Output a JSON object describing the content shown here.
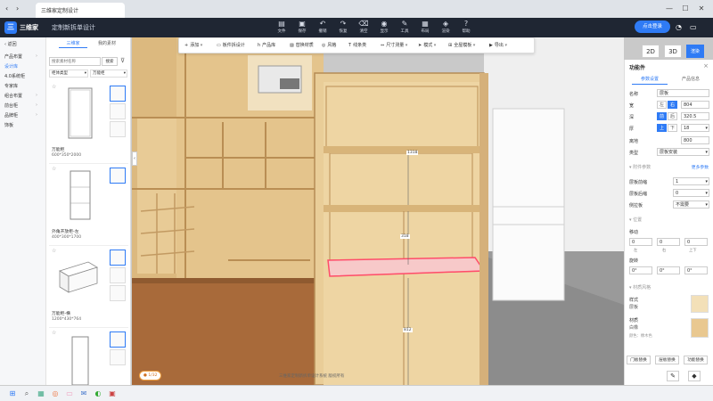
{
  "browser": {
    "tab_title": "三维家定制设计",
    "controls": [
      "—",
      "☐",
      "✕"
    ]
  },
  "header": {
    "logo_text": "三",
    "brand": "三维家",
    "subtitle": "定制新拆单设计",
    "tools": [
      {
        "icon": "file-icon",
        "glyph": "▤",
        "label": "文件"
      },
      {
        "icon": "save-icon",
        "glyph": "▣",
        "label": "保存"
      },
      {
        "icon": "undo-icon",
        "glyph": "↶",
        "label": "撤销"
      },
      {
        "icon": "redo-icon",
        "glyph": "↷",
        "label": "恢复"
      },
      {
        "icon": "clear-icon",
        "glyph": "⌫",
        "label": "清空"
      },
      {
        "icon": "view-icon",
        "glyph": "◉",
        "label": "显示"
      },
      {
        "icon": "tools-icon",
        "glyph": "✎",
        "label": "工具"
      },
      {
        "icon": "layout-icon",
        "glyph": "▦",
        "label": "布局"
      },
      {
        "icon": "render-icon",
        "glyph": "◈",
        "label": "渲染"
      },
      {
        "icon": "help-icon",
        "glyph": "?",
        "label": "帮助"
      }
    ],
    "login_label": "点击登录",
    "right_icons": [
      {
        "icon": "bell-icon",
        "glyph": "◔"
      },
      {
        "icon": "window-icon",
        "glyph": "▭"
      }
    ]
  },
  "left_nav": {
    "back_label": "返回",
    "items": [
      {
        "label": "产品布置",
        "active": false
      },
      {
        "label": "设计库",
        "active": true
      },
      {
        "label": "4.0系统柜",
        "active": false
      },
      {
        "label": "专家库",
        "active": false
      },
      {
        "label": "组合布置",
        "active": false
      },
      {
        "label": "前台柜",
        "active": false
      },
      {
        "label": "品牌柜",
        "active": false
      },
      {
        "label": "饰板",
        "active": false
      }
    ]
  },
  "left_list": {
    "tabs": [
      "三维家",
      "我的素材"
    ],
    "search_placeholder": "搜索素材名称",
    "search_button": "搜索",
    "filters": [
      "柜体类型",
      "万能柜"
    ],
    "cards": [
      {
        "name": "万能柜",
        "size": "600*350*2000"
      },
      {
        "name": "外角开放柜-左",
        "size": "400*300*1700"
      },
      {
        "name": "万能柜-横",
        "size": "1200*430*764"
      },
      {
        "name": "",
        "size": ""
      }
    ]
  },
  "toolbar": {
    "items": [
      {
        "icon": "plus-icon",
        "glyph": "+",
        "label": "添加"
      },
      {
        "icon": "panel-icon",
        "glyph": "▭",
        "label": "板件拆设计"
      },
      {
        "icon": "hardware-icon",
        "glyph": "h",
        "label": "产品库"
      },
      {
        "icon": "texture-icon",
        "glyph": "▨",
        "label": "替换材质"
      },
      {
        "icon": "style-icon",
        "glyph": "◎",
        "label": "风格"
      },
      {
        "icon": "mold-icon",
        "glyph": "T",
        "label": "线条类"
      },
      {
        "icon": "measure-icon",
        "glyph": "⇔",
        "label": "尺寸测量"
      },
      {
        "icon": "cursor-icon",
        "glyph": "➤",
        "label": "模式"
      },
      {
        "icon": "grid-icon",
        "glyph": "⊞",
        "label": "全屋模板"
      },
      {
        "icon": "export-icon",
        "glyph": "▶",
        "label": "导出"
      }
    ]
  },
  "view_toggle": {
    "btn_2d": "2D",
    "btn_3d": "3D",
    "btn_render": "渲染"
  },
  "canvas": {
    "dims": {
      "top": "1318",
      "middle": "318",
      "bottom": "812"
    },
    "info_bar": "三维家定制新拆单设计系统 版权所有",
    "badge": "1/32"
  },
  "right_panel": {
    "title": "功能件",
    "tabs": [
      "参数设置",
      "产品信息"
    ],
    "fields": {
      "name_label": "名称",
      "name_value": "层板",
      "width_label": "宽",
      "width_seg": [
        "左",
        "右"
      ],
      "width_value": "804",
      "depth_label": "深",
      "depth_seg": [
        "前",
        "后"
      ],
      "depth_value": "320.5",
      "thick_label": "厚",
      "thick_seg": [
        "上",
        "下"
      ],
      "thick_value": "18",
      "height_label": "离地",
      "height_value": "800",
      "type_label": "类型",
      "type_value": "层板安装"
    },
    "section_params": "附件参数",
    "more_link": "更多参数",
    "rows": [
      {
        "label": "层板前缩",
        "value": "1"
      },
      {
        "label": "层板后缩",
        "value": "0"
      },
      {
        "label": "侧拉板",
        "value": "不需要"
      }
    ],
    "section_pos": "位置",
    "move_label": "移动",
    "move_values": [
      "0",
      "0",
      "0"
    ],
    "move_units": [
      "左",
      "右",
      "上下"
    ],
    "rotate_label": "旋转",
    "rotate_values": [
      "0°",
      "0°",
      "0°"
    ],
    "section_material": "材质风格",
    "style_label": "样式",
    "style_value": "层板",
    "material_label": "材质",
    "material_value": "白橡",
    "material_sub": "颜色：橡木色",
    "footer_buttons": [
      "门板替换",
      "层板替换",
      "功能替换"
    ]
  },
  "taskbar": {
    "icons": [
      "win-icon",
      "search-icon",
      "explorer-icon",
      "browser-icon",
      "folder-icon",
      "mail-icon",
      "chat-icon",
      "app-icon"
    ]
  },
  "colors": {
    "accent": "#2f7bf5",
    "header_bg": "#1f2633",
    "wood": "#e8c990",
    "wood_dark": "#c28a4c",
    "selection": "#ff4d6a"
  }
}
